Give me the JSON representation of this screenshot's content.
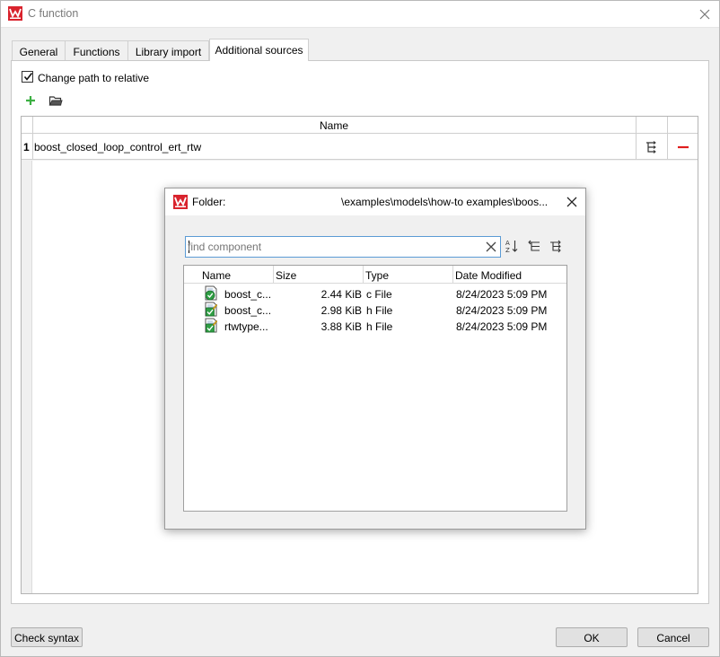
{
  "window": {
    "title": "C function"
  },
  "tabs": [
    "General",
    "Functions",
    "Library import",
    "Additional sources"
  ],
  "options": {
    "change_path_label": "Change path to relative",
    "change_path_checked": true
  },
  "toolbar": {
    "add_icon": "plus-icon",
    "open_icon": "folder-open-icon"
  },
  "sources_table": {
    "column_header": "Name",
    "rows": [
      {
        "index": "1",
        "name": "boost_closed_loop_control_ert_rtw"
      }
    ]
  },
  "buttons": {
    "check_syntax": "Check syntax",
    "ok": "OK",
    "cancel": "Cancel"
  },
  "folder_dialog": {
    "label": "Folder:",
    "path": "\\examples\\models\\how-to examples\\boos...",
    "search_placeholder": "find component",
    "columns": {
      "name": "Name",
      "size": "Size",
      "type": "Type",
      "date": "Date Modified"
    },
    "files": [
      {
        "name": "boost_c...",
        "size": "2.44 KiB",
        "type": "c File",
        "date": "8/24/2023 5:09 PM",
        "icon": "c-file-icon"
      },
      {
        "name": "boost_c...",
        "size": "2.98 KiB",
        "type": "h File",
        "date": "8/24/2023 5:09 PM",
        "icon": "h-file-icon"
      },
      {
        "name": "rtwtype...",
        "size": "3.88 KiB",
        "type": "h File",
        "date": "8/24/2023 5:09 PM",
        "icon": "h-file-icon"
      }
    ]
  },
  "colors": {
    "accent": "#5b9bd5",
    "logo_red": "#d9232d",
    "add_green": "#3cb043",
    "remove_red": "#e01e1e"
  }
}
